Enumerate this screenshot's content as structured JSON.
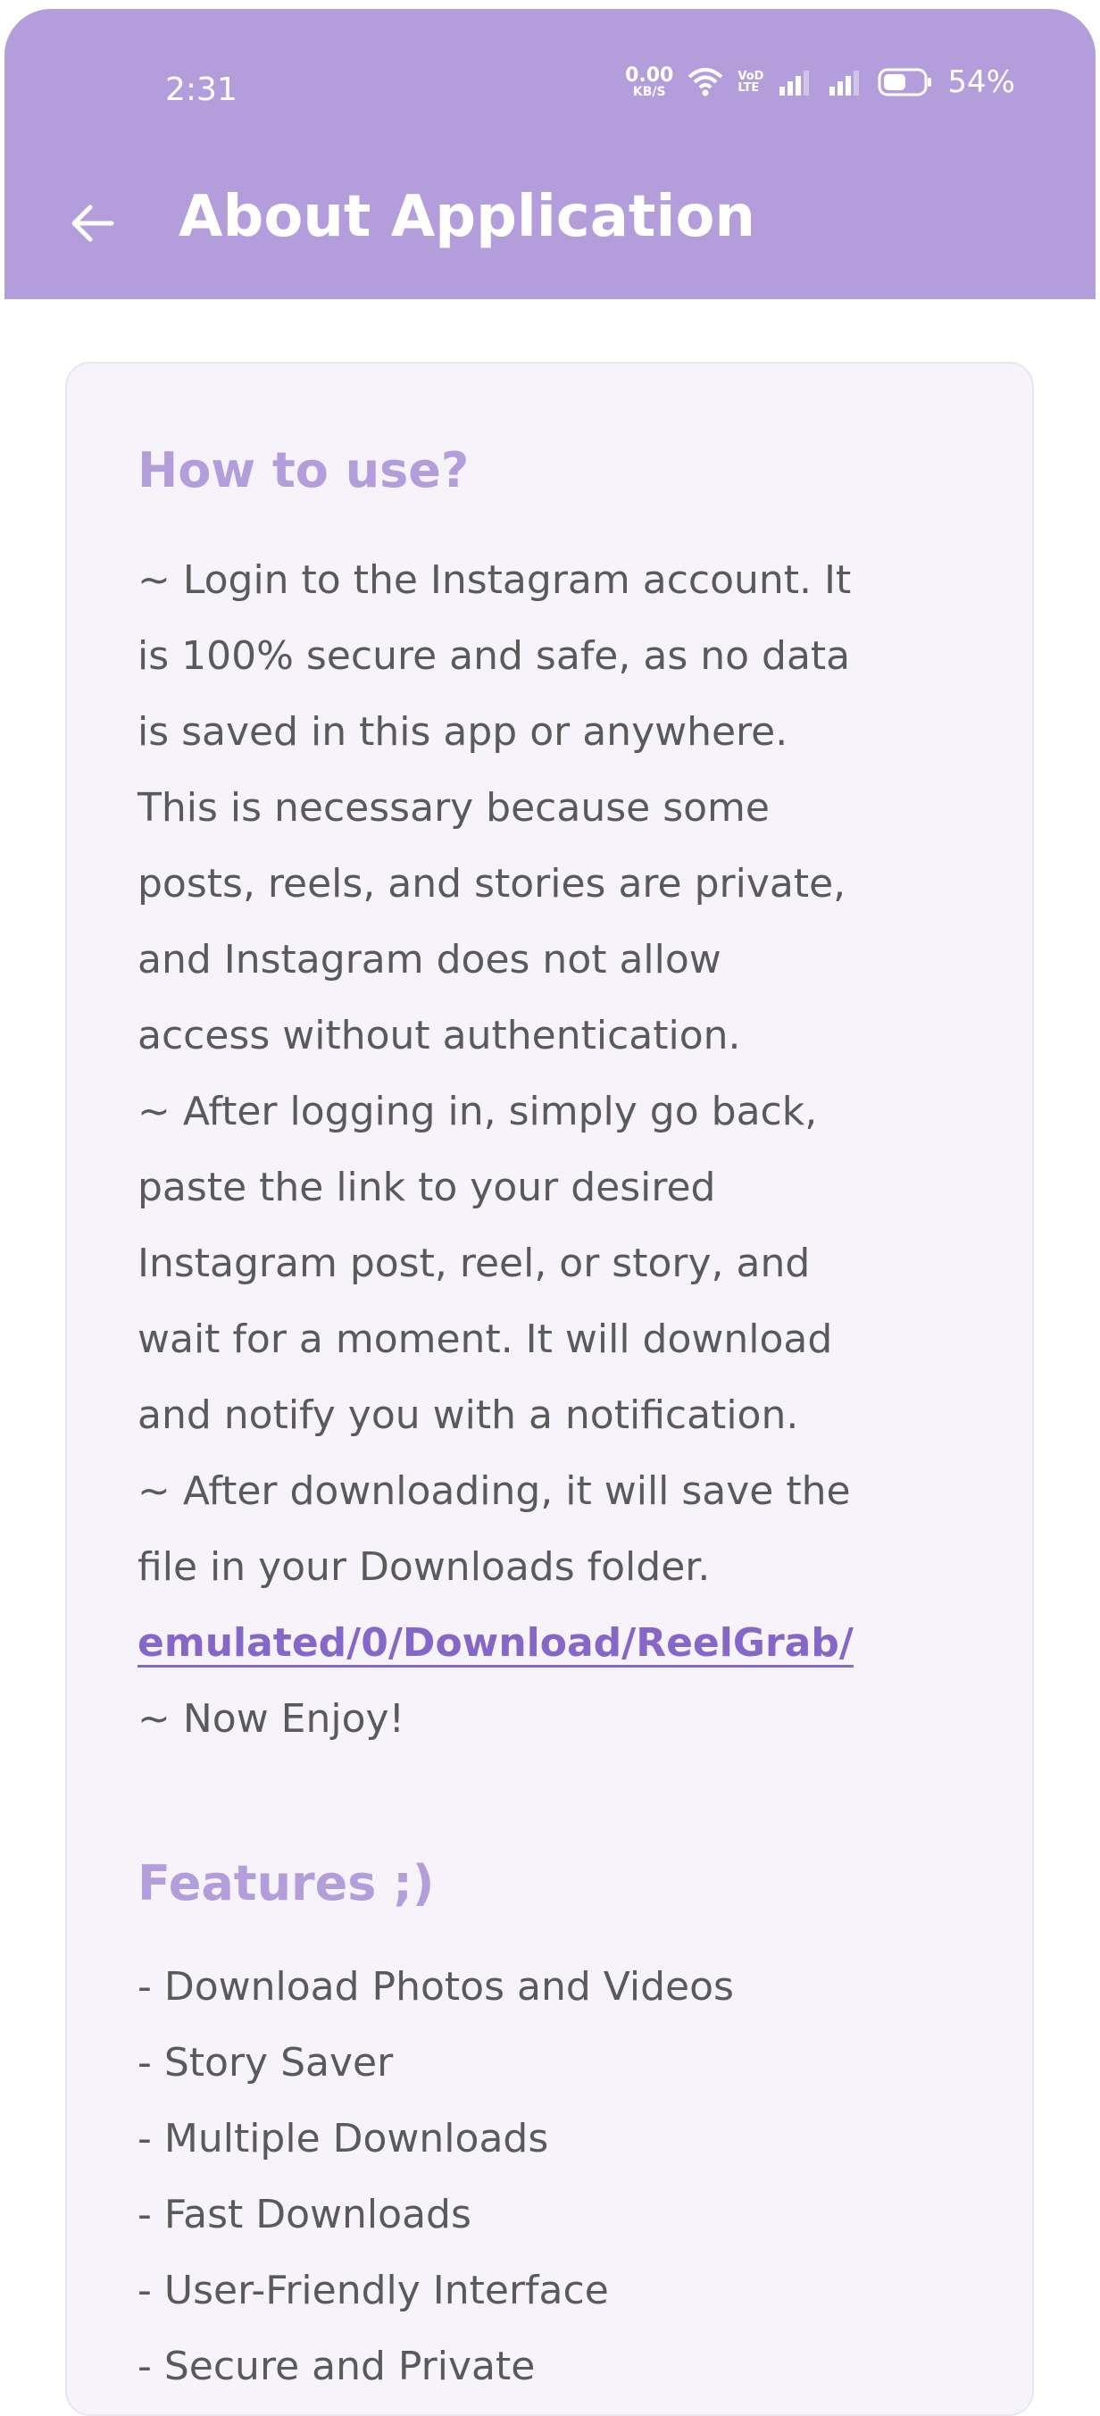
{
  "status_bar": {
    "time": "2:31",
    "net_speed_value": "0.00",
    "net_speed_unit": "KB/S",
    "volte_top": "VoD",
    "volte_bottom": "LTE",
    "battery_percent": "54%",
    "icons": [
      "wifi-icon",
      "signal-icon",
      "signal-icon",
      "battery-icon"
    ]
  },
  "app_bar": {
    "title": "About Application",
    "back_icon": "arrow-left-icon",
    "background": "#b39ddb"
  },
  "how_to_use": {
    "heading": "How to use?",
    "lines": [
      "~ Login to the Instagram account. It",
      "is 100% secure and safe, as no data",
      "is saved in this app or anywhere.",
      "This is necessary because some",
      "posts, reels, and stories are private,",
      "and Instagram does not allow",
      "access without authentication.",
      " ~ After logging in, simply go back,",
      "paste the link to your desired",
      "Instagram post, reel, or story, and",
      "wait for a moment. It will download",
      "and notify you with a notification.",
      "~ After downloading, it will save the",
      "file in your Downloads folder."
    ],
    "link": "emulated/0/Download/ReelGrab/",
    "closing": "~ Now Enjoy!"
  },
  "features": {
    "heading": "Features ;)",
    "items": [
      "- Download Photos and Videos",
      "- Story Saver",
      "- Multiple Downloads",
      "- Fast Downloads",
      "- User-Friendly Interface",
      "- Secure and Private"
    ]
  },
  "colors": {
    "accent": "#b39ddb",
    "link": "#8667c8",
    "card_bg": "#f6f3fa",
    "text": "#5a5a5a"
  }
}
